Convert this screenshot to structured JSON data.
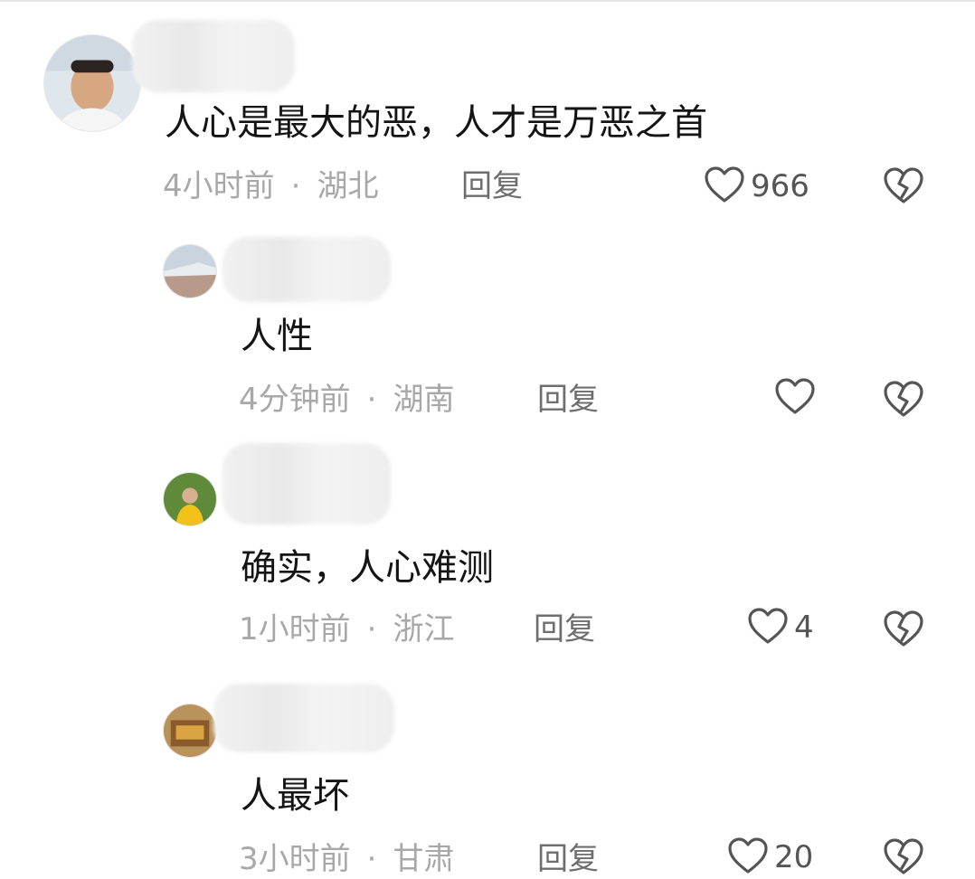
{
  "comments": [
    {
      "text": "人心是最大的恶，人才是万恶之首",
      "time": "4小时前",
      "separator": "·",
      "location": "湖北",
      "reply_label": "回复",
      "likes": "966"
    },
    {
      "text": "人性",
      "time": "4分钟前",
      "separator": "·",
      "location": "湖南",
      "reply_label": "回复",
      "likes": ""
    },
    {
      "text": "确实，人心难测",
      "time": "1小时前",
      "separator": "·",
      "location": "浙江",
      "reply_label": "回复",
      "likes": "4"
    },
    {
      "text": "人最坏",
      "time": "3小时前",
      "separator": "·",
      "location": "甘肃",
      "reply_label": "回复",
      "likes": "20"
    }
  ],
  "icons": {
    "like": "heart-outline-icon",
    "dislike": "broken-heart-icon"
  },
  "colors": {
    "text": "#141414",
    "meta": "#a8a8a8",
    "reply": "#6e6e6e",
    "icon": "#555555"
  }
}
